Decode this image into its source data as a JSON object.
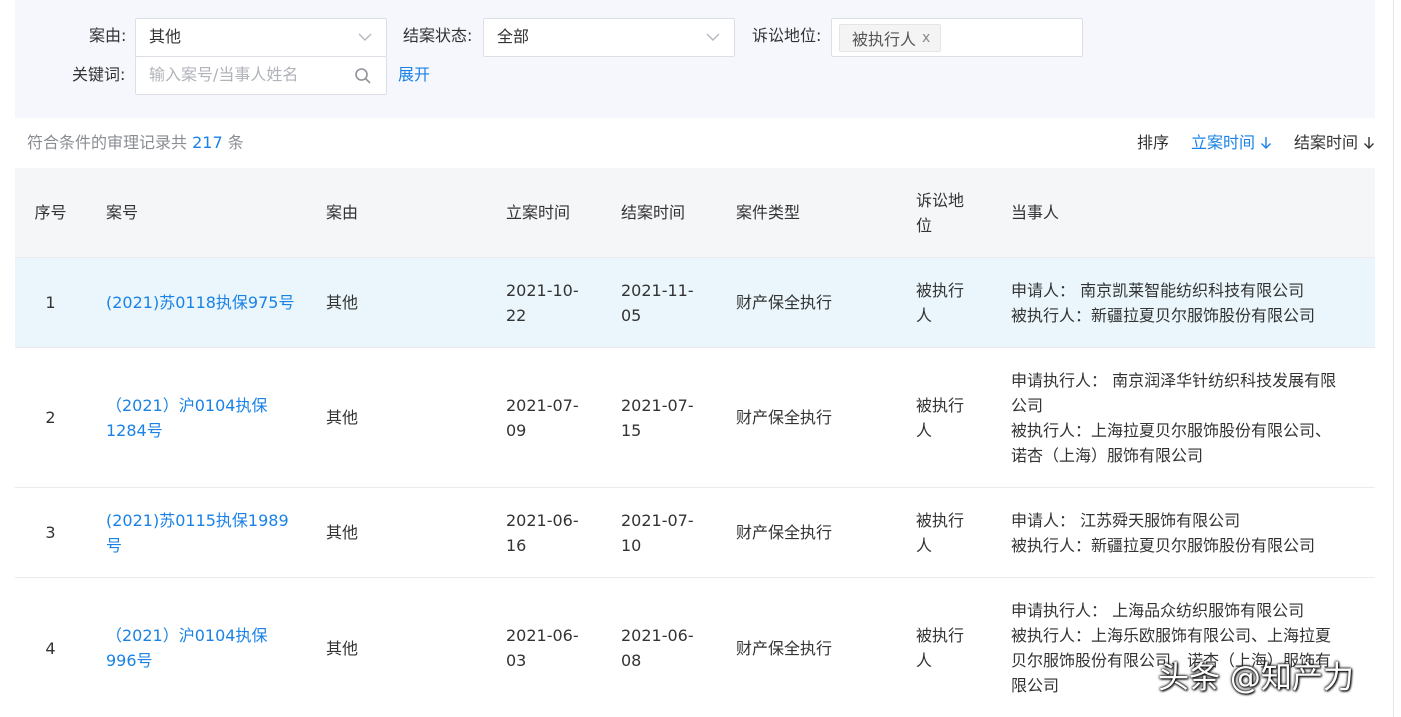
{
  "filters": {
    "cause_label": "案由:",
    "cause_value": "其他",
    "status_label": "结案状态:",
    "status_value": "全部",
    "position_label": "诉讼地位:",
    "position_tag": "被执行人",
    "position_tag_close": "x",
    "keyword_label": "关键词:",
    "keyword_placeholder": "输入案号/当事人姓名",
    "expand_label": "展开"
  },
  "summary": {
    "prefix": "符合条件的审理记录共",
    "count": "217",
    "suffix": "条"
  },
  "sort": {
    "label": "排序",
    "items": [
      {
        "label": "立案时间",
        "active": true
      },
      {
        "label": "结案时间",
        "active": false
      }
    ]
  },
  "table": {
    "headers": {
      "seq": "序号",
      "case_no": "案号",
      "cause": "案由",
      "filed": "立案时间",
      "closed": "结案时间",
      "type": "案件类型",
      "position": "诉讼地\n位",
      "parties": "当事人"
    },
    "rows": [
      {
        "seq": "1",
        "case_no": "(2021)苏0118执保975号",
        "cause": "其他",
        "filed": "2021-10-\n22",
        "closed": "2021-11-\n05",
        "type": "财产保全执行",
        "position": "被执行\n人",
        "parties": [
          "申请人： 南京凯莱智能纺织科技有限公司",
          "被执行人：新疆拉夏贝尔服饰股份有限公司"
        ]
      },
      {
        "seq": "2",
        "case_no": "（2021）沪0104执保\n1284号",
        "cause": "其他",
        "filed": "2021-07-\n09",
        "closed": "2021-07-\n15",
        "type": "财产保全执行",
        "position": "被执行\n人",
        "parties": [
          "申请执行人： 南京润泽华针纺织科技发展有限",
          "公司",
          "被执行人：上海拉夏贝尔服饰股份有限公司、",
          "诺杏（上海）服饰有限公司"
        ]
      },
      {
        "seq": "3",
        "case_no": "(2021)苏0115执保1989\n号",
        "cause": "其他",
        "filed": "2021-06-\n16",
        "closed": "2021-07-\n10",
        "type": "财产保全执行",
        "position": "被执行\n人",
        "parties": [
          "申请人： 江苏舜天服饰有限公司",
          "被执行人：新疆拉夏贝尔服饰股份有限公司"
        ]
      },
      {
        "seq": "4",
        "case_no": "（2021）沪0104执保\n996号",
        "cause": "其他",
        "filed": "2021-06-\n03",
        "closed": "2021-06-\n08",
        "type": "财产保全执行",
        "position": "被执行\n人",
        "parties": [
          "申请执行人： 上海品众纺织服饰有限公司",
          "被执行人：上海乐欧服饰有限公司、上海拉夏",
          "贝尔服饰股份有限公司、诺杏（上海）服饰有",
          "限公司"
        ]
      }
    ]
  },
  "watermark": "头条 @知产力",
  "colors": {
    "accent": "#1a82e6",
    "filter_bg": "#f5f7fc",
    "header_bg": "#f5f6f8",
    "highlight_row": "#eaf6fb"
  }
}
